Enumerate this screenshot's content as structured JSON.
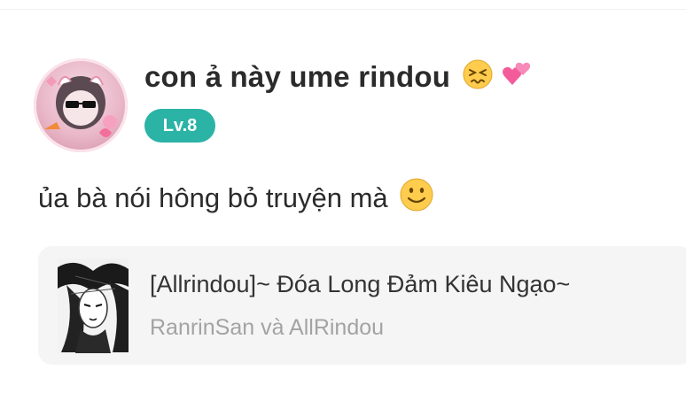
{
  "comment": {
    "username": "con ả này ume rindou",
    "username_emojis": [
      "persevering-face",
      "two-hearts"
    ],
    "level_badge": "Lv.8",
    "message": "ủa bà nói hông bỏ truyện mà",
    "message_emoji": "slightly-smiling-face"
  },
  "story_card": {
    "title": "[Allrindou]~ Đóa Long Đảm Kiêu Ngạo~",
    "author": "RanrinSan và AllRindou"
  },
  "colors": {
    "badge": "#2bb3a6",
    "card_background": "#f5f5f5",
    "author_text": "#a3a3a3"
  }
}
